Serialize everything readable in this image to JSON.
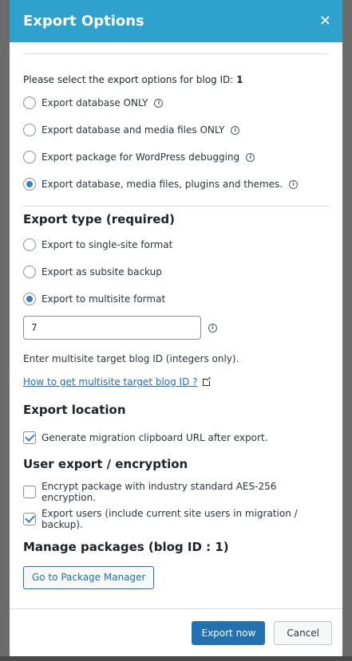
{
  "modal": {
    "title": "Export Options",
    "close_symbol": "✕"
  },
  "intro": {
    "text": "Please select the export options for blog ID: ",
    "blog_id": "1"
  },
  "export_options": [
    {
      "label": "Export database ONLY",
      "checked": false,
      "info": true
    },
    {
      "label": "Export database and media files ONLY",
      "checked": false,
      "info": true
    },
    {
      "label": "Export package for WordPress debugging",
      "checked": false,
      "info": true
    },
    {
      "label": "Export database, media files, plugins and themes.",
      "checked": true,
      "info": true
    }
  ],
  "export_type": {
    "heading": "Export type (required)",
    "options": [
      {
        "label": "Export to single-site format",
        "checked": false
      },
      {
        "label": "Export as subsite backup",
        "checked": false
      },
      {
        "label": "Export to multisite format",
        "checked": true
      }
    ],
    "blog_id_value": "7",
    "help_text": "Enter multisite target blog ID (integers only).",
    "help_link": "How to get multisite target blog ID ?"
  },
  "export_location": {
    "heading": "Export location",
    "clipboard_label": "Generate migration clipboard URL after export.",
    "clipboard_checked": true
  },
  "user_export": {
    "heading": "User export / encryption",
    "encrypt_label": "Encrypt package with industry standard AES-256 encryption.",
    "encrypt_checked": false,
    "users_label": "Export users (include current site users in migration / backup).",
    "users_checked": true
  },
  "manage_packages": {
    "heading": "Manage packages (blog ID : 1)",
    "button_label": "Go to Package Manager"
  },
  "footer": {
    "export_now": "Export now",
    "cancel": "Cancel"
  },
  "colors": {
    "header": "#2ea2cc",
    "primary": "#2271b1"
  }
}
